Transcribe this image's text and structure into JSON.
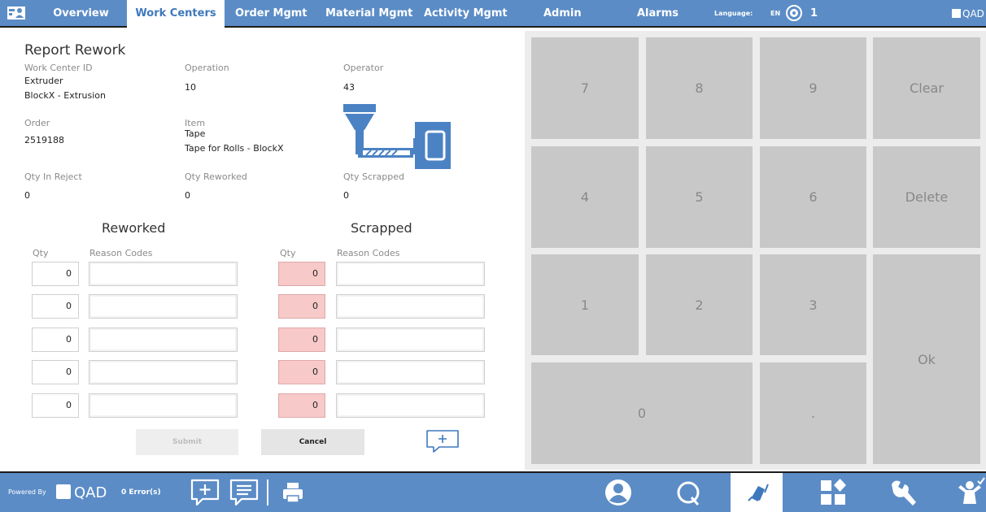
{
  "nav": {
    "tabs": [
      {
        "label": "Overview"
      },
      {
        "label": "Work Centers"
      },
      {
        "label": "Order Mgmt"
      },
      {
        "label": "Material Mgmt"
      },
      {
        "label": "Activity Mgmt"
      },
      {
        "label": "Admin"
      },
      {
        "label": "Alarms"
      }
    ],
    "language_label": "Language:",
    "language_value": "EN",
    "alarm_count": "1",
    "brand": "QAD"
  },
  "form": {
    "title": "Report Rework",
    "work_center_id": {
      "label": "Work Center ID",
      "value": "Extruder",
      "description": "BlockX - Extrusion"
    },
    "operation": {
      "label": "Operation",
      "value": "10"
    },
    "operator": {
      "label": "Operator",
      "value": "43"
    },
    "order": {
      "label": "Order",
      "value": "2519188"
    },
    "item": {
      "label": "Item",
      "value": "Tape",
      "description": "Tape for Rolls - BlockX"
    },
    "qty_in_reject": {
      "label": "Qty In Reject",
      "value": "0"
    },
    "qty_reworked": {
      "label": "Qty Reworked",
      "value": "0"
    },
    "qty_scrapped": {
      "label": "Qty Scrapped",
      "value": "0"
    },
    "reworked": {
      "heading": "Reworked",
      "qty_header": "Qty",
      "reason_header": "Reason Codes",
      "rows": [
        "0",
        "0",
        "0",
        "0",
        "0"
      ]
    },
    "scrapped": {
      "heading": "Scrapped",
      "qty_header": "Qty",
      "reason_header": "Reason Codes",
      "rows": [
        "0",
        "0",
        "0",
        "0",
        "0"
      ]
    },
    "submit_label": "Submit",
    "cancel_label": "Cancel",
    "machine_icon": "extruder-machine-icon"
  },
  "keypad": {
    "k7": "7",
    "k8": "8",
    "k9": "9",
    "clear": "Clear",
    "k4": "4",
    "k5": "5",
    "k6": "6",
    "delete": "Delete",
    "k1": "1",
    "k2": "2",
    "k3": "3",
    "ok": "Ok",
    "k0": "0",
    "dot": "."
  },
  "footer": {
    "powered_by": "Powered By",
    "brand": "QAD",
    "errors": "0 Error(s)",
    "icons": [
      "add-comment-icon",
      "comments-icon",
      "print-icon",
      "user-icon",
      "q-icon",
      "report-icon",
      "dashboard-icon",
      "wrench-icon",
      "worker-icon"
    ]
  },
  "colors": {
    "bar_blue": "#5b8cc6",
    "active_tab_text": "#3e78bd",
    "scrap_qty_bg": "#f7c9c9",
    "key_bg": "#c8c8c8"
  }
}
